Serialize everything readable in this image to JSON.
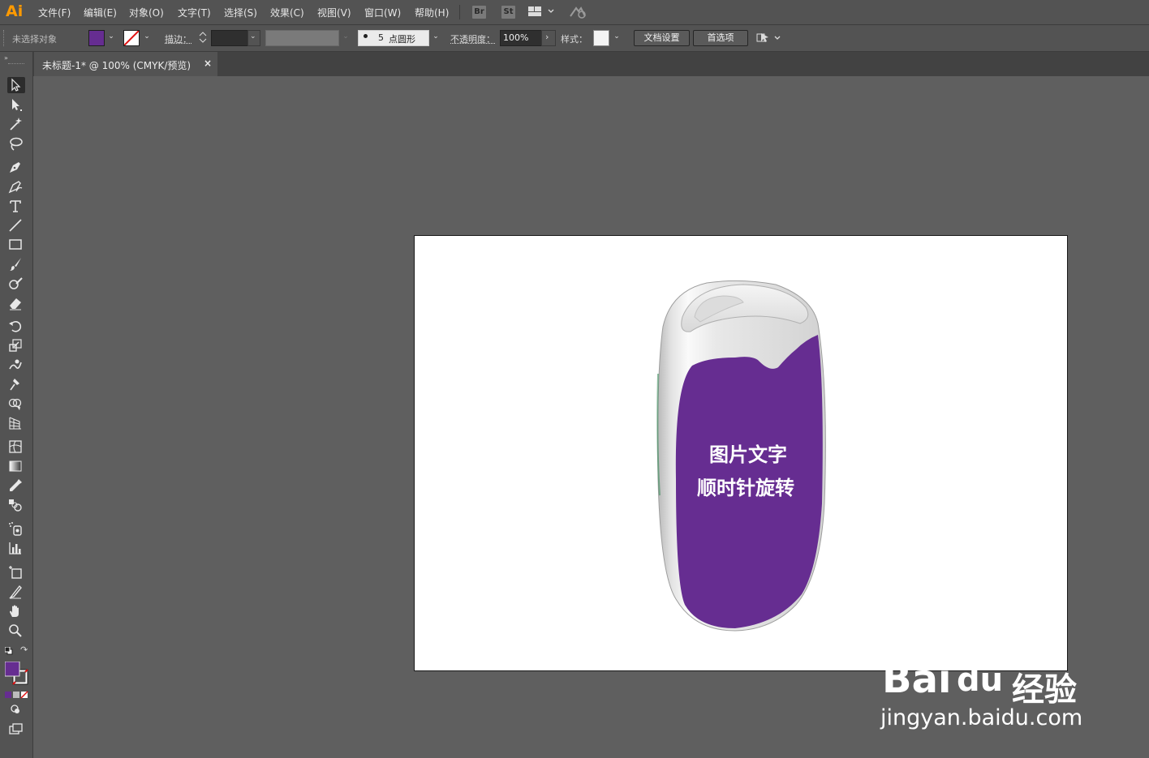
{
  "app": {
    "logo": "Ai"
  },
  "menu": {
    "items": [
      "文件(F)",
      "编辑(E)",
      "对象(O)",
      "文字(T)",
      "选择(S)",
      "效果(C)",
      "视图(V)",
      "窗口(W)",
      "帮助(H)"
    ],
    "bridge_label": "Br",
    "stock_label": "St"
  },
  "control_bar": {
    "selection_status": "未选择对象",
    "fill_color": "#662d91",
    "stroke_label": "描边：",
    "brush_count": "5",
    "brush_name": "点圆形",
    "opacity_label": "不透明度：",
    "opacity_value": "100%",
    "style_label": "样式：",
    "doc_setup_button": "文档设置",
    "preferences_button": "首选项"
  },
  "document_tab": {
    "title": "未标题-1* @ 100% (CMYK/预览)",
    "close_label": "×"
  },
  "artwork": {
    "text_line1": "图片文字",
    "text_line2": "顺时针旋转",
    "body_color": "#662d91"
  },
  "watermark": {
    "brand_left": "Bai",
    "brand_mid": "du",
    "brand_cn": "经验",
    "url": "jingyan.baidu.com"
  }
}
